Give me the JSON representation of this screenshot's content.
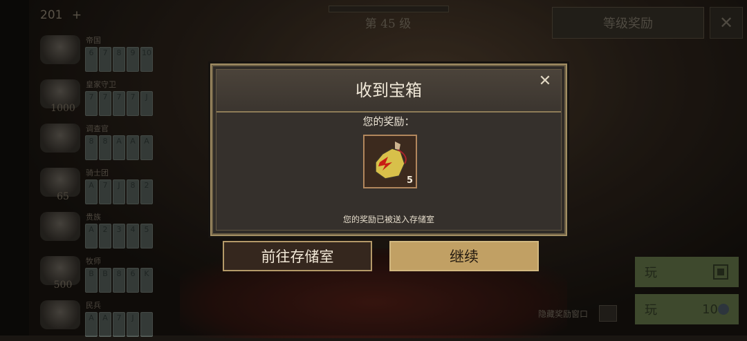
{
  "topbar": {
    "money": "201",
    "plus": "+",
    "level_label": "第 45 级",
    "reward_button": "等级奖励",
    "close_glyph": "✕"
  },
  "sets": [
    {
      "name": "帝国",
      "count": "",
      "cards": [
        "6",
        "7",
        "8",
        "9",
        "10"
      ]
    },
    {
      "name": "皇家守卫",
      "count": "1000",
      "cards": [
        "7",
        "7",
        "7",
        "7",
        "J"
      ]
    },
    {
      "name": "调查官",
      "count": "",
      "cards": [
        "8",
        "8",
        "A",
        "A",
        "A"
      ]
    },
    {
      "name": "骑士团",
      "count": "65",
      "cards": [
        "A",
        "7",
        "J",
        "8",
        "2"
      ]
    },
    {
      "name": "贵族",
      "count": "",
      "cards": [
        "A",
        "2",
        "3",
        "4",
        "5"
      ]
    },
    {
      "name": "牧师",
      "count": "500",
      "cards": [
        "B",
        "B",
        "8",
        "6",
        "K"
      ]
    },
    {
      "name": "民兵",
      "count": "",
      "cards": [
        "A",
        "A",
        "7",
        "J",
        ""
      ]
    }
  ],
  "side": {
    "play1_label": "玩",
    "play2_label": "玩",
    "play2_count": "10",
    "hide_reward_label": "隐藏奖励窗口"
  },
  "dialog": {
    "title": "收到宝箱",
    "close_glyph": "✕",
    "reward_label": "您的奖励：",
    "item": {
      "name": "potion-flask-icon",
      "quantity": "5"
    },
    "sent_note": "您的奖励已被送入存储室",
    "storage_button": "前往存储室",
    "continue_button": "继续"
  }
}
